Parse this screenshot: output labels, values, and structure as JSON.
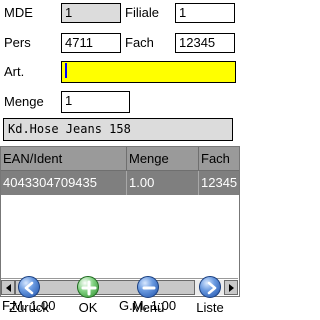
{
  "form": {
    "mde_label": "MDE",
    "mde_value": "1",
    "filiale_label": "Filiale",
    "filiale_value": "1",
    "pers_label": "Pers",
    "pers_value": "4711",
    "fach_label": "Fach",
    "fach_value": "12345",
    "art_label": "Art.",
    "art_value": "",
    "menge_label": "Menge",
    "menge_value": "1",
    "article_desc": "Kd.Hose Jeans 158"
  },
  "grid": {
    "columns": [
      "EAN/Ident",
      "Menge",
      "Fach"
    ],
    "rows": [
      [
        "4043304709435",
        "1.00",
        "12345"
      ]
    ]
  },
  "summary": {
    "fm": "F.M. 1.00",
    "gm": "G.M. 1.00"
  },
  "toolbar": {
    "back_label": "Zurück",
    "ok_label": "OK",
    "menu_label": "Menü",
    "list_label": "Liste"
  },
  "colors": {
    "focus_field": "#ffff00",
    "readonly_field": "#dcdcdc",
    "grid_header": "#9a9a9a",
    "grid_selected_row": "#7f7f7f"
  }
}
